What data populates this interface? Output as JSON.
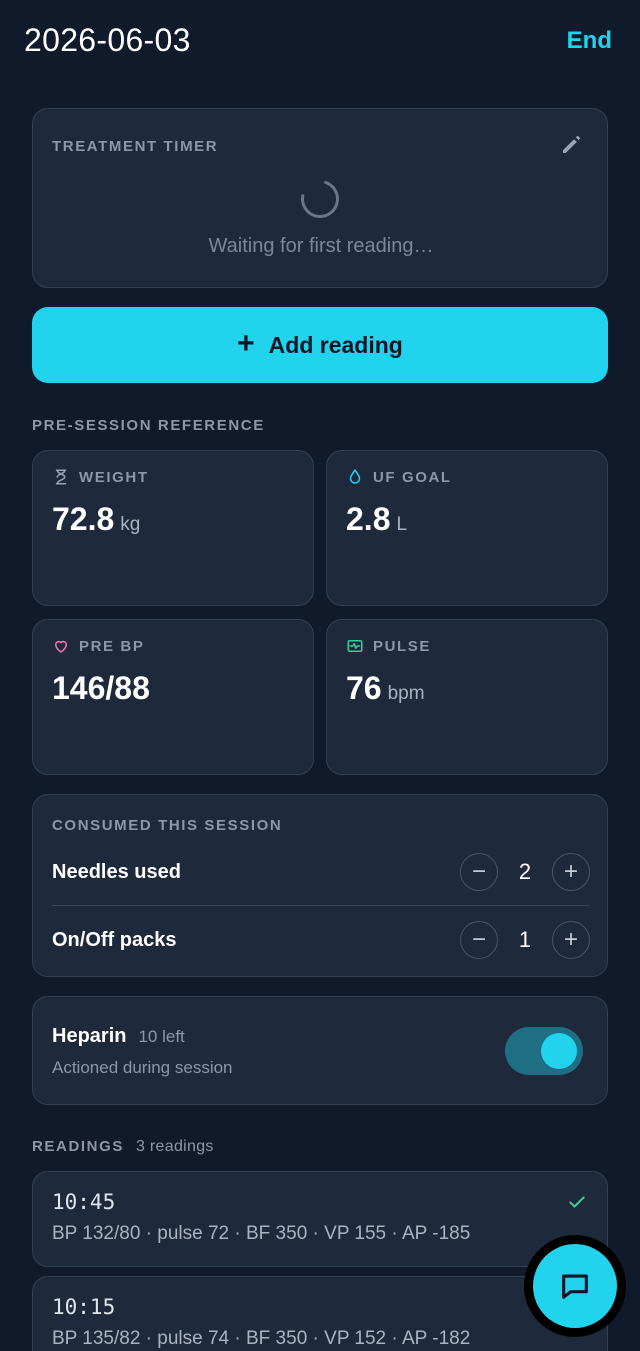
{
  "header": {
    "date": "2026-06-03",
    "end_label": "End"
  },
  "timer": {
    "label": "TREATMENT TIMER",
    "status": "Waiting for first reading…"
  },
  "add_reading": {
    "label": "Add reading"
  },
  "pre_session": {
    "label": "PRE-SESSION REFERENCE",
    "weight": {
      "label": "WEIGHT",
      "value": "72.8",
      "unit": "kg"
    },
    "uf_goal": {
      "label": "UF GOAL",
      "value": "2.8",
      "unit": "L"
    },
    "pre_bp": {
      "label": "PRE BP",
      "value": "146/88"
    },
    "pulse": {
      "label": "PULSE",
      "value": "76",
      "unit": "bpm"
    }
  },
  "consumed": {
    "label": "CONSUMED THIS SESSION",
    "items": [
      {
        "name": "Needles used",
        "count": "2"
      },
      {
        "name": "On/Off packs",
        "count": "1"
      }
    ]
  },
  "heparin": {
    "name": "Heparin",
    "left": "10 left",
    "subtitle": "Actioned during session",
    "enabled": true
  },
  "readings": {
    "label": "READINGS",
    "count_label": "3 readings",
    "items": [
      {
        "time": "10:45",
        "detail": "BP 132/80 · pulse 72 · BF 350 · VP 155 · AP -185"
      },
      {
        "time": "10:15",
        "detail": "BP 135/82 · pulse 74 · BF 350 · VP 152 · AP -182"
      }
    ]
  },
  "colors": {
    "accent": "#22d3ee",
    "background": "#111a2b",
    "card": "#1e293b",
    "heart": "#f472b6",
    "pulse": "#34d399"
  }
}
